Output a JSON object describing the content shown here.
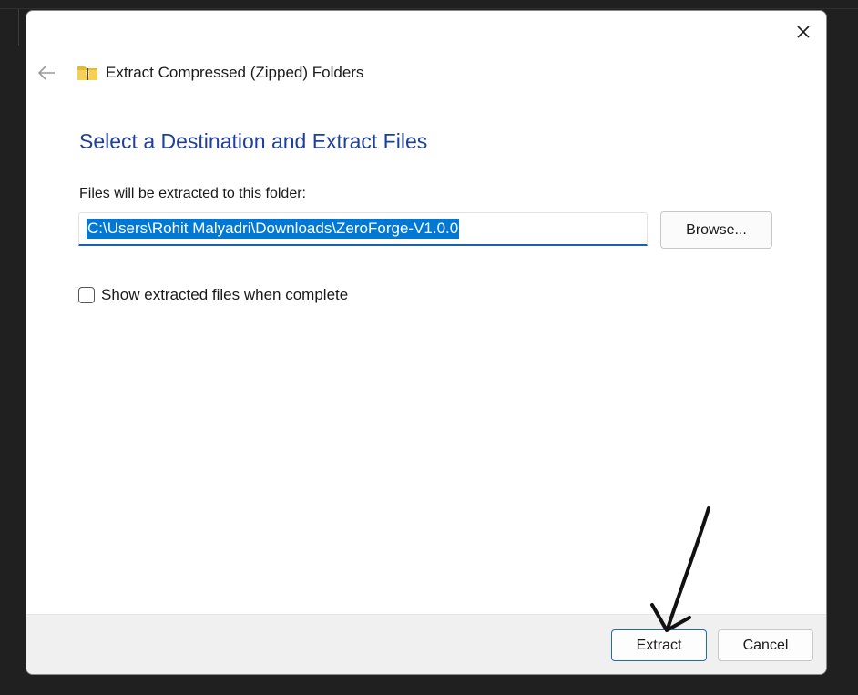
{
  "dialog": {
    "wizard_title": "Extract Compressed (Zipped) Folders",
    "heading": "Select a Destination and Extract Files",
    "destination_label": "Files will be extracted to this folder:",
    "destination_path": "C:\\Users\\Rohit Malyadri\\Downloads\\ZeroForge-V1.0.0",
    "browse_label": "Browse...",
    "checkbox_label": "Show extracted files when complete",
    "checkbox_checked": false,
    "extract_label": "Extract",
    "cancel_label": "Cancel"
  },
  "icons": {
    "close": "close-icon",
    "back": "back-arrow-icon",
    "folder": "zip-folder-icon",
    "annotation": "annotation-arrow"
  },
  "colors": {
    "heading": "#1f3f9a",
    "selection": "#0078d4",
    "accent_border": "#1a6ac6",
    "footer": "#f0f0f0"
  }
}
